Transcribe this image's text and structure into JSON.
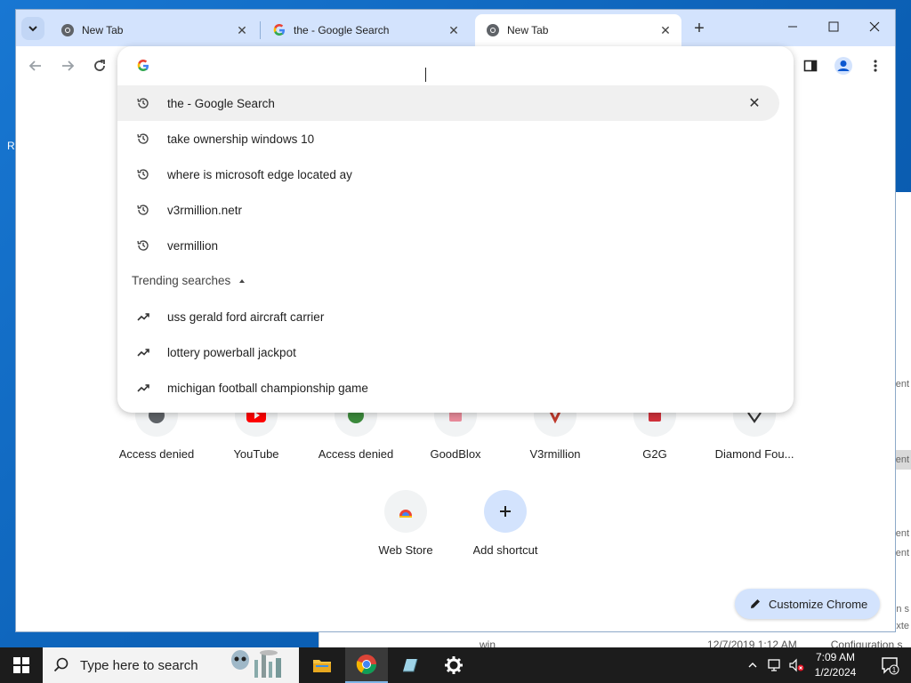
{
  "desktop": {
    "glyph": "R"
  },
  "background_window": {
    "side_texts": [
      "ent",
      "ent",
      "ent",
      "ent",
      "n s",
      "exte",
      "on s"
    ],
    "file_row": {
      "name": "win",
      "date": "12/7/2019 1:12 AM",
      "type": "Configuration s"
    }
  },
  "browser": {
    "tabs": [
      {
        "title": "New Tab",
        "favicon": "chrome-icon"
      },
      {
        "title": "the - Google Search",
        "favicon": "google-g-icon"
      },
      {
        "title": "New Tab",
        "favicon": "chrome-icon",
        "active": true
      }
    ],
    "omnibox": {
      "value": "",
      "suggestions": [
        {
          "text": "the - Google Search",
          "icon": "history-icon"
        },
        {
          "text": "take ownership windows 10",
          "icon": "history-icon"
        },
        {
          "text": "where is microsoft edge located ay",
          "icon": "history-icon"
        },
        {
          "text": "v3rmillion.netr",
          "icon": "history-icon"
        },
        {
          "text": "vermillion",
          "icon": "history-icon"
        }
      ],
      "trending_header": "Trending searches",
      "trending": [
        {
          "text": "uss gerald ford aircraft carrier",
          "icon": "trending-icon"
        },
        {
          "text": "lottery powerball jackpot",
          "icon": "trending-icon"
        },
        {
          "text": "michigan football championship game",
          "icon": "trending-icon"
        }
      ]
    },
    "shortcuts_row1": [
      {
        "label": "Access denied",
        "color": "#5f6368"
      },
      {
        "label": "YouTube",
        "color": "#ff0000"
      },
      {
        "label": "Access denied",
        "color": "#3c8a3c"
      },
      {
        "label": "GoodBlox",
        "color": "#e88a9a"
      },
      {
        "label": "V3rmillion",
        "color": "#c0392b"
      },
      {
        "label": "G2G",
        "color": "#d0313b"
      },
      {
        "label": "Diamond Fou...",
        "color": "#333333"
      }
    ],
    "shortcuts_row2": [
      {
        "label": "Web Store"
      },
      {
        "label": "Add shortcut"
      }
    ],
    "customize_label": "Customize Chrome"
  },
  "taskbar": {
    "search_placeholder": "Type here to search",
    "time": "7:09 AM",
    "date": "1/2/2024",
    "notification_count": "1"
  }
}
